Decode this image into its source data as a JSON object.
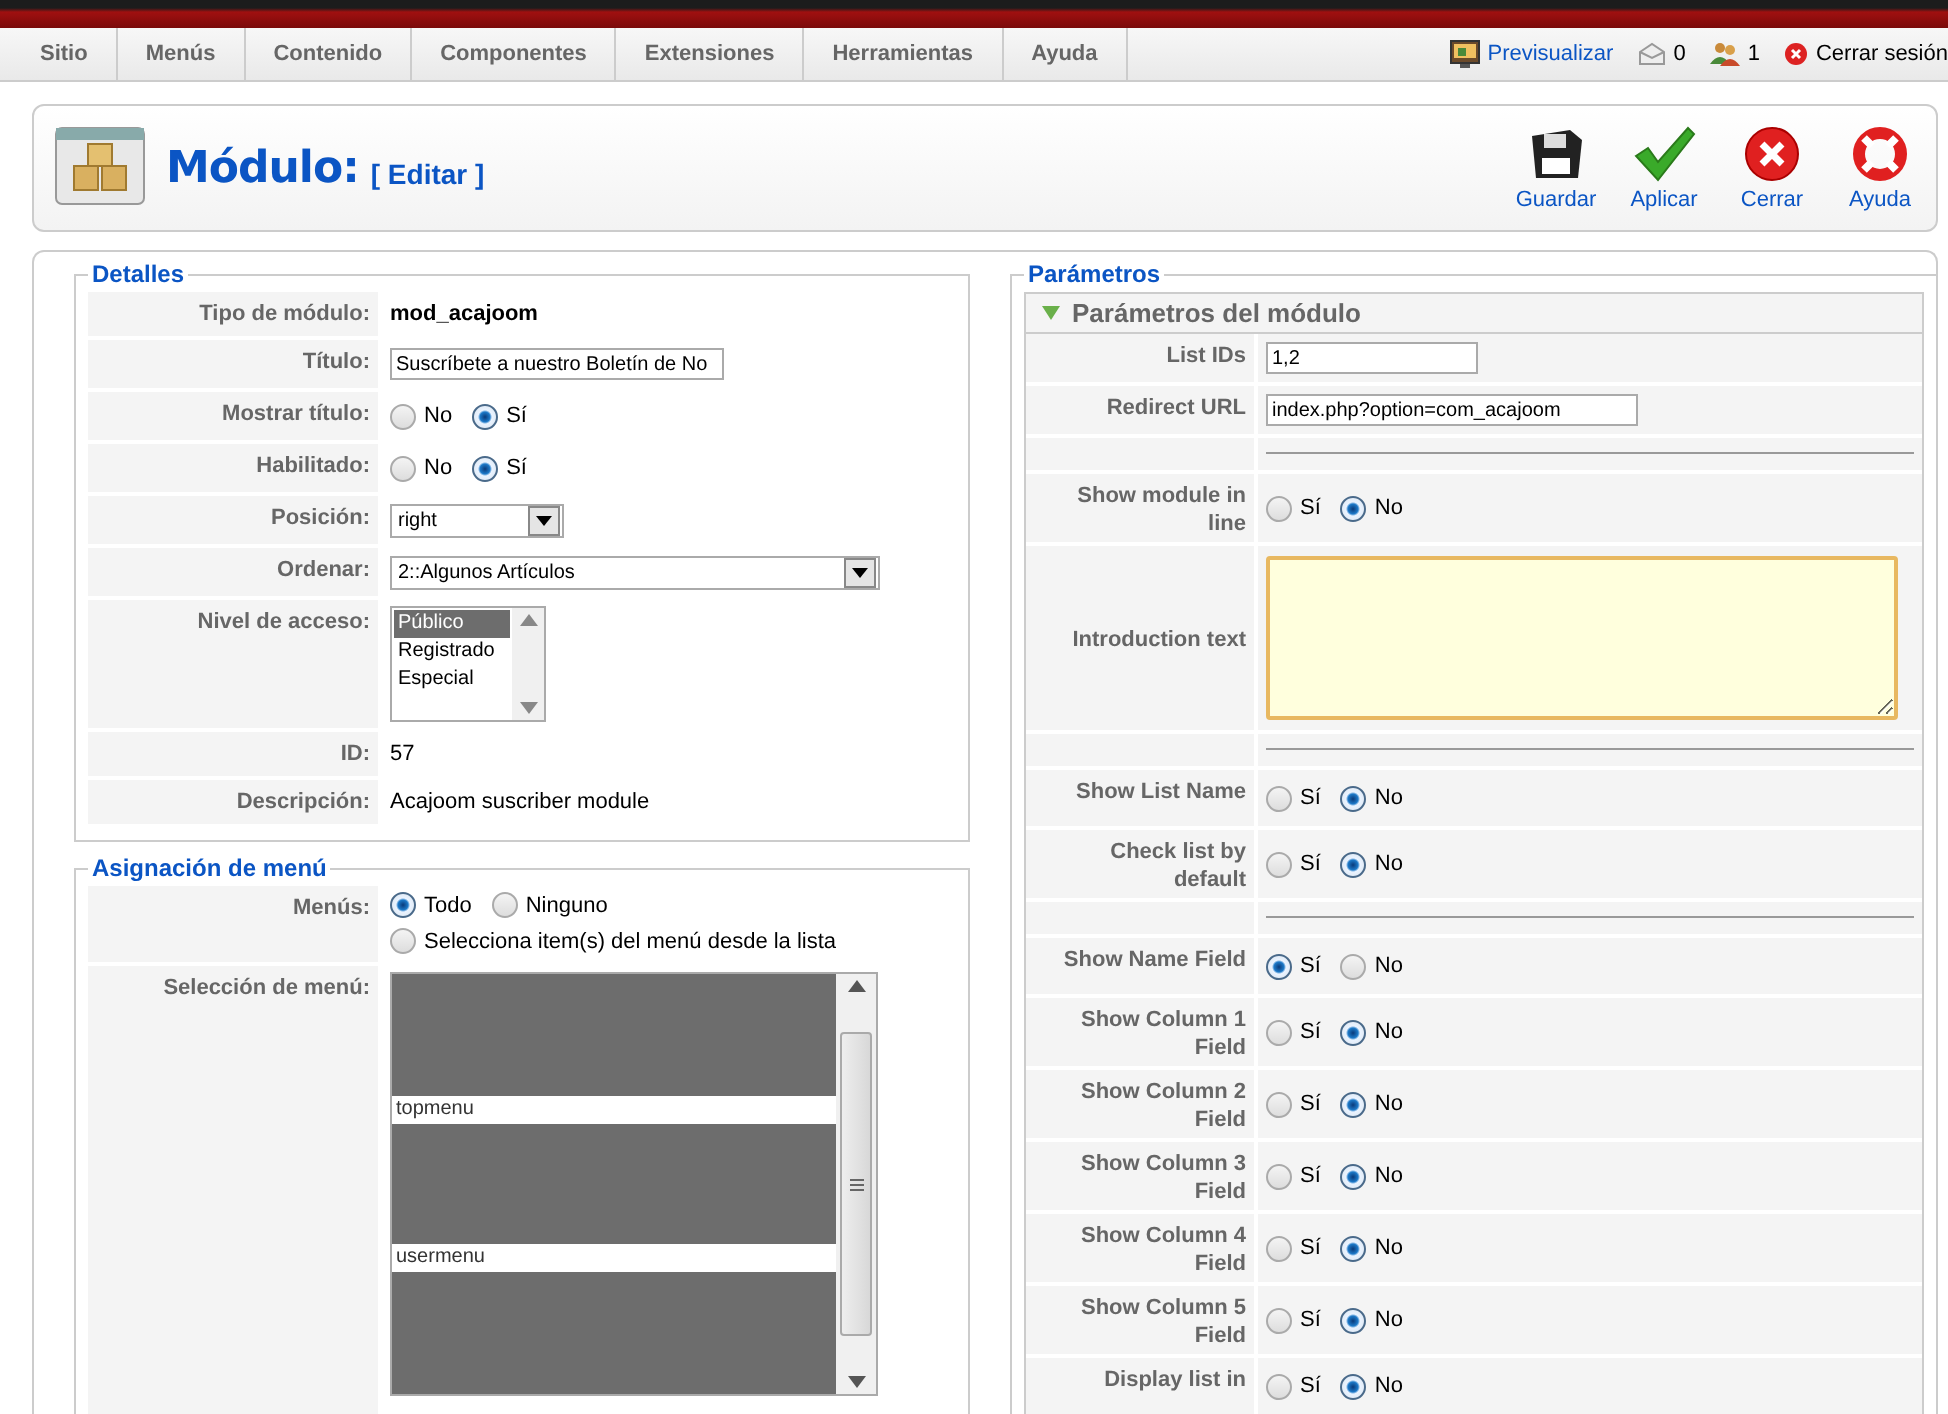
{
  "menubar": {
    "items": [
      {
        "label": "Sitio"
      },
      {
        "label": "Menús"
      },
      {
        "label": "Contenido"
      },
      {
        "label": "Componentes"
      },
      {
        "label": "Extensiones"
      },
      {
        "label": "Herramientas"
      },
      {
        "label": "Ayuda"
      }
    ],
    "status": [
      {
        "kind": "preview",
        "label": "Previsualizar"
      },
      {
        "kind": "messages",
        "label": "0"
      },
      {
        "kind": "users",
        "label": "1"
      },
      {
        "kind": "logout",
        "label": "Cerrar sesión"
      }
    ]
  },
  "toolbar": {
    "title": "Módulo:",
    "subtitle": "[ Editar ]",
    "buttons": [
      {
        "kind": "save",
        "label": "Guardar"
      },
      {
        "kind": "apply",
        "label": "Aplicar"
      },
      {
        "kind": "close",
        "label": "Cerrar"
      },
      {
        "kind": "help",
        "label": "Ayuda"
      }
    ]
  },
  "details": {
    "legend": "Detalles",
    "rows": [
      {
        "kind": "static",
        "label": "Tipo de módulo:",
        "value": "mod_acajoom",
        "bold": true
      },
      {
        "kind": "input",
        "label": "Título:",
        "value": "Suscríbete a nuestro Boletín de No"
      },
      {
        "kind": "radio",
        "label": "Mostrar título:",
        "options": [
          {
            "label": "No",
            "selected": false
          },
          {
            "label": "Sí",
            "selected": true
          }
        ]
      },
      {
        "kind": "radio",
        "label": "Habilitado:",
        "options": [
          {
            "label": "No",
            "selected": false
          },
          {
            "label": "Sí",
            "selected": true
          }
        ]
      },
      {
        "kind": "select",
        "label": "Posición:",
        "value": "right",
        "wide": false
      },
      {
        "kind": "select",
        "label": "Ordenar:",
        "value": "2::Algunos Artículos",
        "wide": true
      },
      {
        "kind": "listbox",
        "label": "Nivel de acceso:",
        "options": [
          {
            "label": "Público",
            "selected": true
          },
          {
            "label": "Registrado",
            "selected": false
          },
          {
            "label": "Especial",
            "selected": false
          }
        ]
      },
      {
        "kind": "static",
        "label": "ID:",
        "value": "57",
        "bold": false
      },
      {
        "kind": "static",
        "label": "Descripción:",
        "value": "Acajoom suscriber module",
        "bold": false
      }
    ]
  },
  "menu_assignment": {
    "legend": "Asignación de menú",
    "menus_label": "Menús:",
    "menus_options": [
      {
        "label": "Todo",
        "selected": true
      },
      {
        "label": "Ninguno",
        "selected": false
      },
      {
        "label": "Selecciona item(s) del menú desde la lista",
        "selected": false
      }
    ],
    "selection_label": "Selección de menú:",
    "selection_items": [
      {
        "selected": true
      },
      {
        "label": "topmenu",
        "selected": false
      },
      {
        "selected": true
      },
      {
        "label": "usermenu",
        "selected": false
      },
      {
        "selected": true
      }
    ]
  },
  "parameters": {
    "legend": "Parámetros",
    "panel_title": "Parámetros del módulo",
    "expanded": true,
    "rows": [
      {
        "kind": "input",
        "label": "List IDs",
        "value": "1,2",
        "wide": false
      },
      {
        "kind": "input",
        "label": "Redirect URL",
        "value": "index.php?option=com_acajoom",
        "wide": true
      },
      {
        "kind": "separator"
      },
      {
        "kind": "radio",
        "label": "Show module in line",
        "options": [
          {
            "label": "Sí",
            "selected": false
          },
          {
            "label": "No",
            "selected": true
          }
        ]
      },
      {
        "kind": "textarea",
        "label": "Introduction text"
      },
      {
        "kind": "separator"
      },
      {
        "kind": "radio",
        "label": "Show List Name",
        "options": [
          {
            "label": "Sí",
            "selected": false
          },
          {
            "label": "No",
            "selected": true
          }
        ]
      },
      {
        "kind": "radio",
        "label": "Check list by default",
        "options": [
          {
            "label": "Sí",
            "selected": false
          },
          {
            "label": "No",
            "selected": true
          }
        ]
      },
      {
        "kind": "separator"
      },
      {
        "kind": "radio",
        "label": "Show Name Field",
        "options": [
          {
            "label": "Sí",
            "selected": true
          },
          {
            "label": "No",
            "selected": false
          }
        ]
      },
      {
        "kind": "radio",
        "label": "Show Column 1 Field",
        "options": [
          {
            "label": "Sí",
            "selected": false
          },
          {
            "label": "No",
            "selected": true
          }
        ]
      },
      {
        "kind": "radio",
        "label": "Show Column 2 Field",
        "options": [
          {
            "label": "Sí",
            "selected": false
          },
          {
            "label": "No",
            "selected": true
          }
        ]
      },
      {
        "kind": "radio",
        "label": "Show Column 3 Field",
        "options": [
          {
            "label": "Sí",
            "selected": false
          },
          {
            "label": "No",
            "selected": true
          }
        ]
      },
      {
        "kind": "radio",
        "label": "Show Column 4 Field",
        "options": [
          {
            "label": "Sí",
            "selected": false
          },
          {
            "label": "No",
            "selected": true
          }
        ]
      },
      {
        "kind": "radio",
        "label": "Show Column 5 Field",
        "options": [
          {
            "label": "Sí",
            "selected": false
          },
          {
            "label": "No",
            "selected": true
          }
        ]
      },
      {
        "kind": "radio",
        "label": "Display list in",
        "options": [
          {
            "label": "Sí",
            "selected": false
          },
          {
            "label": "No",
            "selected": true
          }
        ]
      }
    ]
  }
}
